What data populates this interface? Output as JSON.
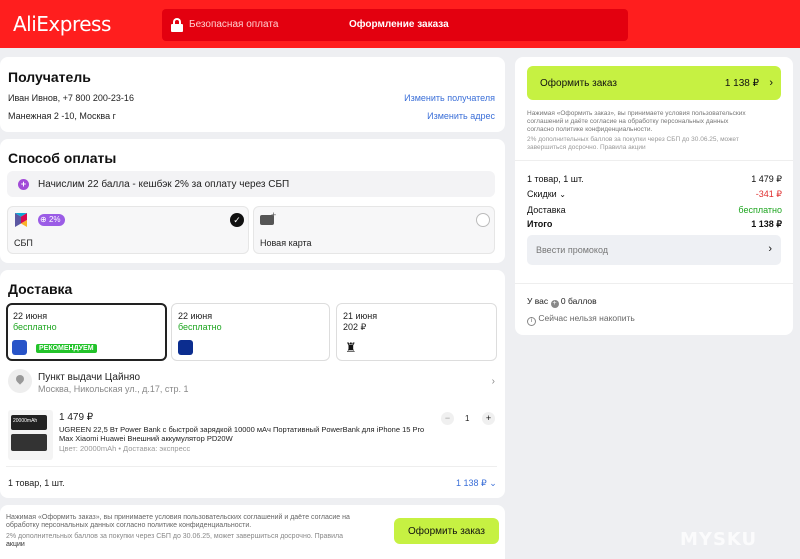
{
  "header": {
    "logo": "AliExpress",
    "secure": "Безопасная оплата",
    "order_title": "Оформление заказа"
  },
  "recipient": {
    "title": "Получатель",
    "person": "Иван Ивнов, +7 800 200-23-16",
    "change_recipient": "Изменить получателя",
    "address": "Манежная 2 -10, Москва г",
    "change_address": "Изменить адрес"
  },
  "payment": {
    "title": "Способ оплаты",
    "promo": "Начислим 22 балла - кешбэк 2% за оплату через СБП",
    "sbp_badge": "2%",
    "sbp_label": "СБП",
    "card_label": "Новая карта",
    "selected": "СБП"
  },
  "delivery": {
    "title": "Доставка",
    "options": [
      {
        "date": "22 июня",
        "price": "бесплатно",
        "badge": "РЕКОМЕНДУЕМ"
      },
      {
        "date": "22 июня",
        "price": "бесплатно"
      },
      {
        "date": "21 июня",
        "price": "202 ₽"
      }
    ],
    "pickup_title": "Пункт выдачи Цайняо",
    "pickup_address": "Москва, Никольская ул., д.17, стр. 1"
  },
  "product": {
    "price": "1 479 ₽",
    "name_line1": "UGREEN 22,5 Вт Power Bank с быстрой зарядкой 10000 мАч Портативный PowerBank для iPhone 15 Pro",
    "name_line2": "Max Xiaomi Huawei Внешний аккумулятор PD20W",
    "meta": "Цвет: 20000mAh • Доставка: экспресс",
    "qty": "1",
    "minus": "−",
    "plus": "+",
    "image_text": "20000mAh"
  },
  "cart_summary": {
    "count": "1 товар, 1 шт.",
    "total": "1 138 ₽"
  },
  "bottom": {
    "terms_line1": "Нажимая «Оформить заказ», вы принимаете условия пользовательских соглашений и даёте согласие на",
    "terms_line2": "обработку персональных данных согласно политике конфиденциальности.",
    "terms_line3": "2% дополнительных баллов за покупки через СБП до 30.06.25, может завершиться досрочно. Правила",
    "terms_line4": "акции",
    "button": "Оформить заказ"
  },
  "sidebar": {
    "button_label": "Оформить заказ",
    "button_price": "1 138 ₽",
    "terms_line1": "Нажимая «Оформить заказ», вы принимаете условия пользовательских",
    "terms_line2": "соглашений и даёте согласие на обработку персональных данных",
    "terms_line3": "согласно политике конфиденциальности.",
    "sbp_line1": "2% дополнительных баллов за покупки через СБП до 30.06.25, может",
    "sbp_line2": "завершиться досрочно. Правила акции",
    "rows": [
      {
        "label": "1 товар, 1 шт.",
        "value": "1 479 ₽"
      },
      {
        "label": "Скидки",
        "value": "-341 ₽"
      },
      {
        "label": "Доставка",
        "value": "бесплатно"
      },
      {
        "label": "Итого",
        "value": "1 138 ₽"
      }
    ],
    "promo_placeholder": "Ввести промокод",
    "points_prefix": "У вас",
    "points_value": "0 баллов",
    "points_note": "Сейчас нельзя накопить"
  },
  "watermark": "MYSKU",
  "colors": {
    "brand_red": "#ff1e1e",
    "accent_green": "#c6f142",
    "link_blue": "#3b6fd8",
    "discount_red": "#e03030",
    "success_green": "#1ea520",
    "promo_purple": "#9b5ce6"
  }
}
